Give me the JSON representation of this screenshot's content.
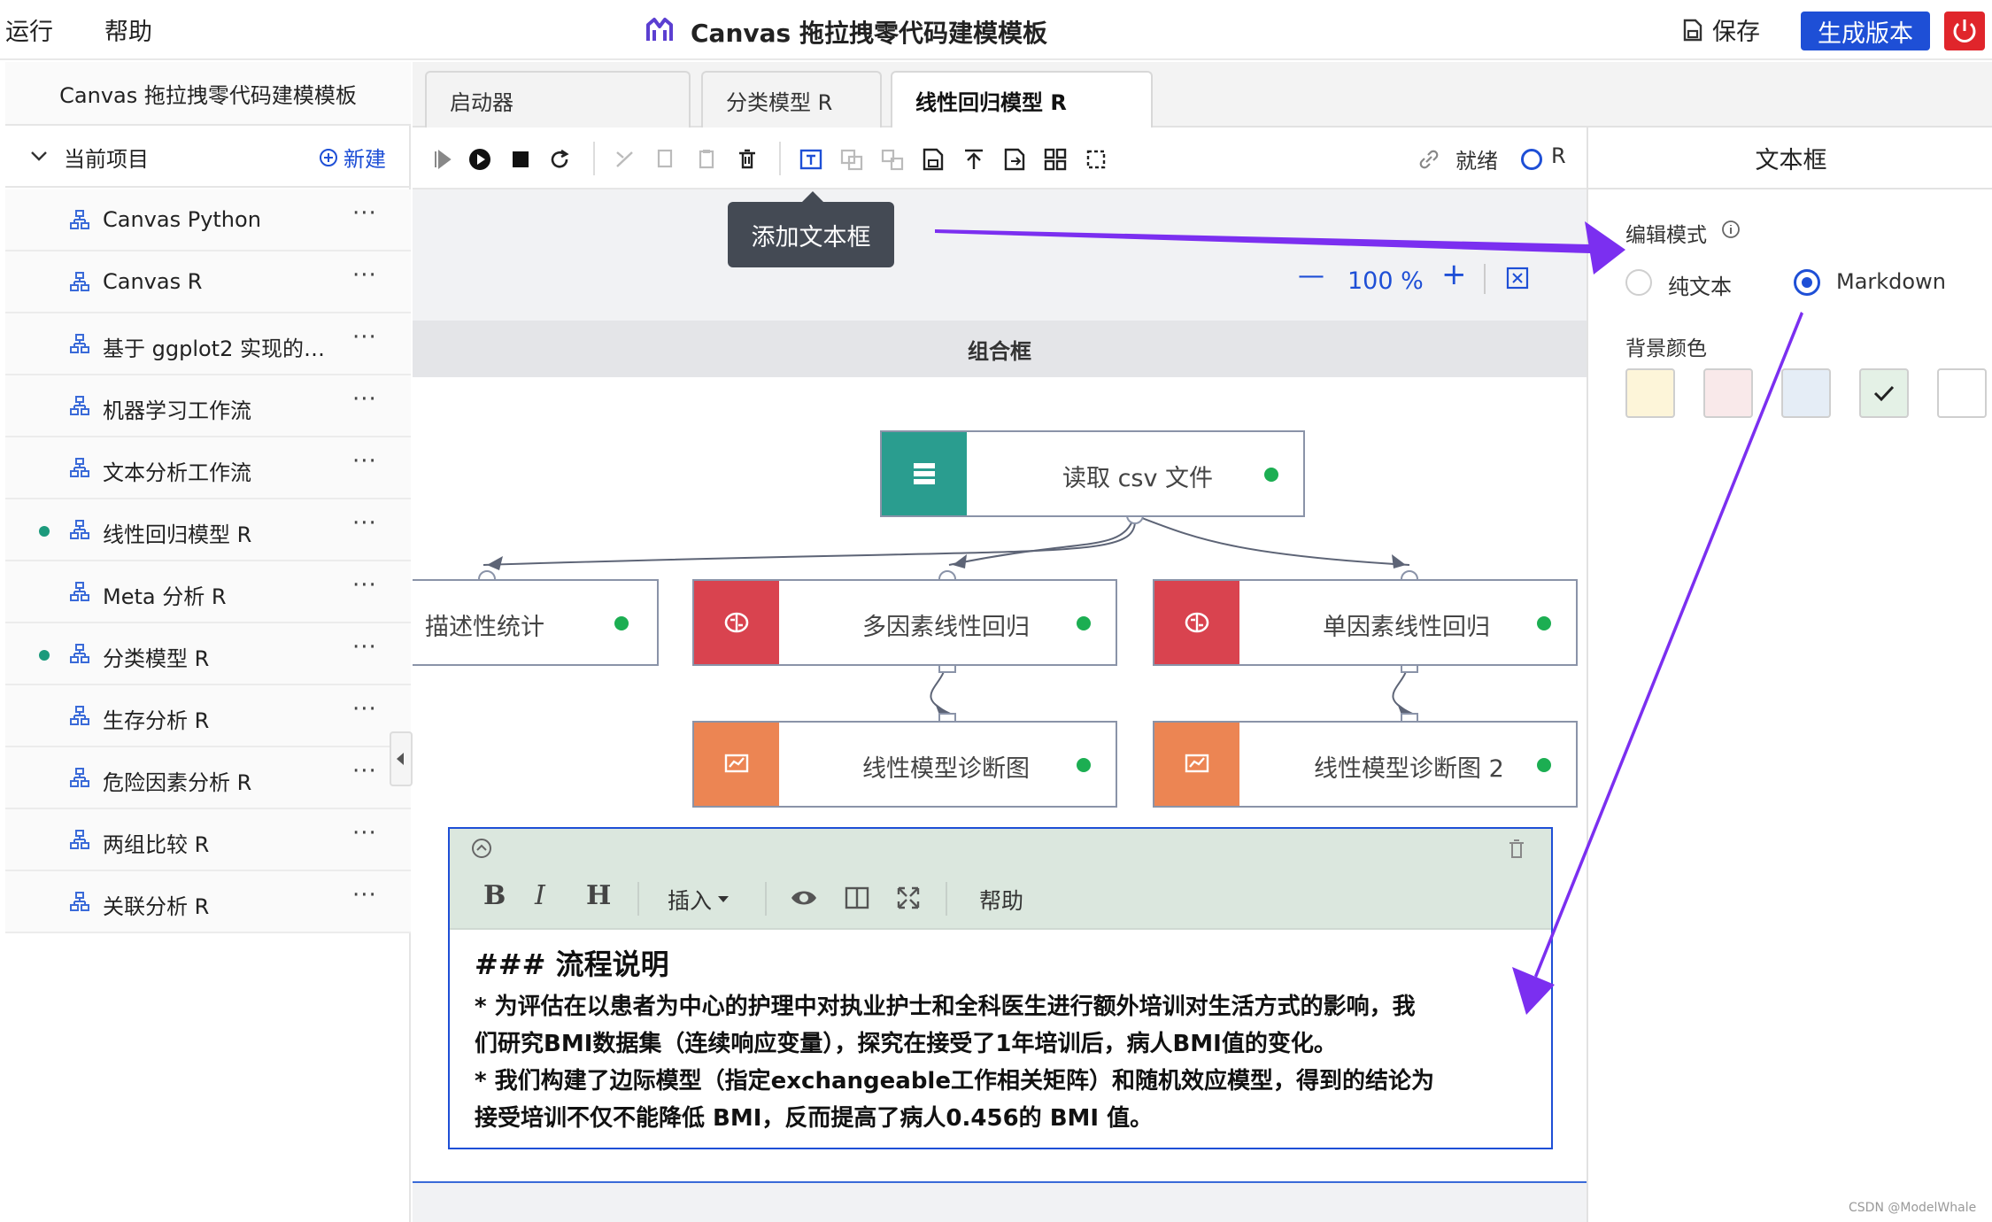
{
  "menu": {
    "run": "运行",
    "help": "帮助"
  },
  "app_title": "Canvas 拖拉拽零代码建模模板",
  "header_actions": {
    "save": "保存",
    "generate": "生成版本"
  },
  "sidebar": {
    "title": "Canvas 拖拉拽零代码建模模板",
    "section": "当前项目",
    "new": "新建",
    "items": [
      {
        "label": "Canvas Python",
        "active": false
      },
      {
        "label": "Canvas R",
        "active": false
      },
      {
        "label": "基于 ggplot2 实现的柱…",
        "active": false
      },
      {
        "label": "机器学习工作流",
        "active": false
      },
      {
        "label": "文本分析工作流",
        "active": false
      },
      {
        "label": "线性回归模型 R",
        "active": true
      },
      {
        "label": "Meta 分析 R",
        "active": false
      },
      {
        "label": "分类模型 R",
        "active": true
      },
      {
        "label": "生存分析 R",
        "active": false
      },
      {
        "label": "危险因素分析 R",
        "active": false
      },
      {
        "label": "两组比较 R",
        "active": false
      },
      {
        "label": "关联分析 R",
        "active": false
      }
    ]
  },
  "tabs": [
    {
      "label": "启动器",
      "active": false
    },
    {
      "label": "分类模型 R",
      "active": false
    },
    {
      "label": "线性回归模型 R",
      "active": true
    }
  ],
  "toolbar": {
    "status": "就绪",
    "kernel": "R",
    "tooltip": "添加文本框"
  },
  "zoom": {
    "value": "100 %"
  },
  "group_title": "组合框",
  "nodes": {
    "read_csv": "读取 csv 文件",
    "desc_stats": "描述性统计",
    "multi_reg": "多因素线性回归",
    "single_reg": "单因素线性回归",
    "diag1": "线性模型诊断图",
    "diag2": "线性模型诊断图 2"
  },
  "node_colors": {
    "data": "#2a9d8f",
    "model": "#d9434f",
    "plot": "#ec8553"
  },
  "editor": {
    "tools": {
      "bold": "B",
      "italic": "I",
      "heading": "H",
      "insert": "插入",
      "help": "帮助"
    },
    "heading": "### 流程说明",
    "lines": [
      "* 为评估在以患者为中心的护理中对执业护士和全科医生进行额外培训对生活方式的影响，我",
      "们研究BMI数据集（连续响应变量），探究在接受了1年培训后，病人BMI值的变化。",
      "* 我们构建了边际模型（指定exchangeable工作相关矩阵）和随机效应模型，得到的结论为",
      "接受培训不仅不能降低 BMI，反而提高了病人0.456的 BMI 值。"
    ]
  },
  "right_panel": {
    "title": "文本框",
    "edit_mode_label": "编辑模式",
    "mode_plain": "纯文本",
    "mode_markdown": "Markdown",
    "selected_mode": "Markdown",
    "bg_label": "背景颜色",
    "swatches": [
      "#fdf5d9",
      "#f9e9ea",
      "#e5edf6",
      "#e4f1e6",
      "#ffffff"
    ],
    "selected_swatch": 3
  },
  "watermark": "CSDN @ModelWhale"
}
